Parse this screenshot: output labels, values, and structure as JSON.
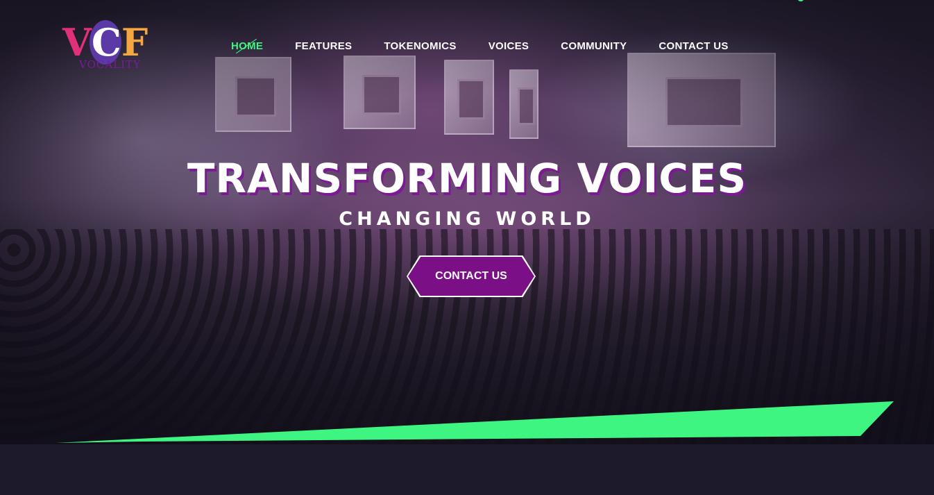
{
  "brand": {
    "logo_letters": [
      "V",
      "C",
      "F"
    ],
    "logo_subtitle": "VOCALITY"
  },
  "nav": {
    "items": [
      {
        "label": "HOME",
        "active": true
      },
      {
        "label": "FEATURES",
        "active": false
      },
      {
        "label": "TOKENOMICS",
        "active": false
      },
      {
        "label": "VOICES",
        "active": false
      },
      {
        "label": "COMMUNITY",
        "active": false
      },
      {
        "label": "CONTACT US",
        "active": false
      }
    ]
  },
  "hero": {
    "headline": "TRANSFORMING VOICES",
    "subheadline": "CHANGING WORLD",
    "cta_label": "CONTACT US"
  },
  "colors": {
    "accent_green": "#3ef582",
    "brand_purple": "#7b0f85",
    "headline_shadow": "#7b1a93",
    "background": "#1d1b2b"
  }
}
